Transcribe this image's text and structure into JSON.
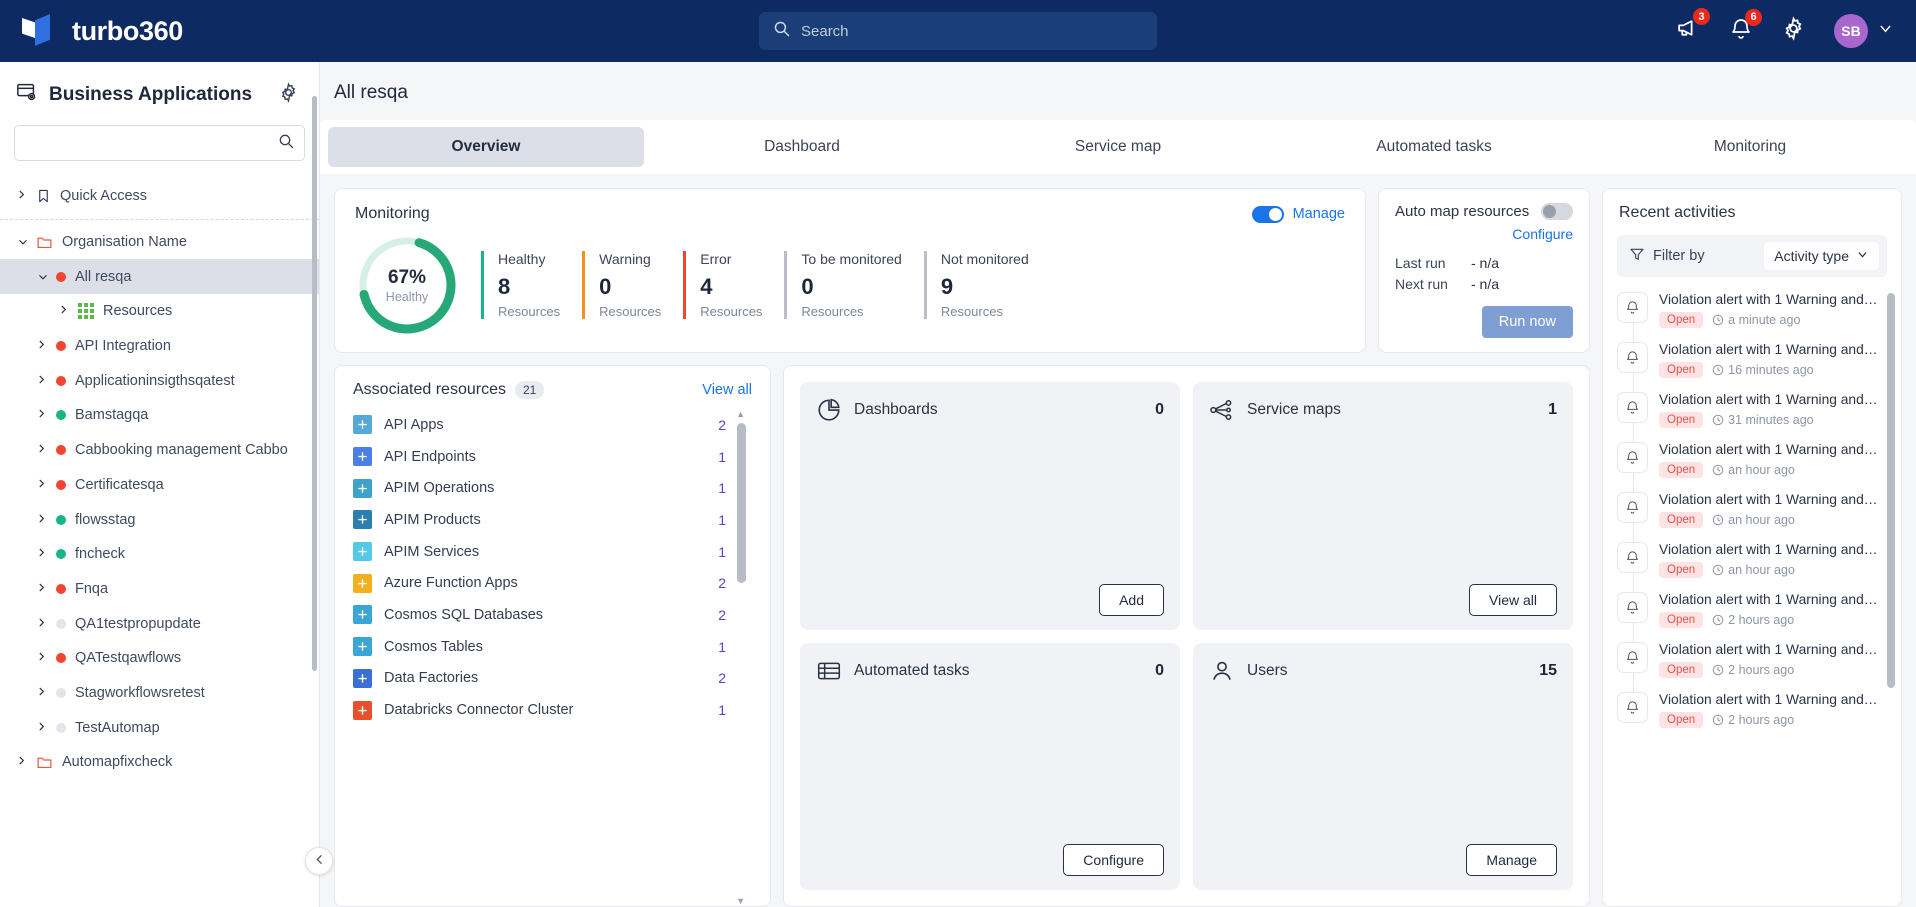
{
  "topbar": {
    "brand": "turbo360",
    "search_placeholder": "Search",
    "announcements_badge": "3",
    "notifications_badge": "6",
    "avatar_initials": "SB"
  },
  "sidebar": {
    "title": "Business Applications",
    "search_value": "",
    "search_placeholder": "",
    "groups": [
      {
        "label": "Quick Access",
        "icon": "bookmark-icon",
        "depth": 1,
        "expanded": false,
        "type": "bookmark"
      },
      {
        "label": "Organisation Name",
        "icon": "folder-icon",
        "depth": 1,
        "expanded": true,
        "type": "folder"
      },
      {
        "label": "All resqa",
        "depth": 2,
        "expanded": true,
        "selected": true,
        "status": "#f2442e"
      },
      {
        "label": "Resources",
        "depth": 3,
        "expanded": false,
        "type": "grid"
      },
      {
        "label": "API Integration",
        "depth": 2,
        "expanded": false,
        "status": "#f2442e"
      },
      {
        "label": "Applicationinsigthsqatest",
        "depth": 2,
        "expanded": false,
        "status": "#f2442e"
      },
      {
        "label": "Bamstagqa",
        "depth": 2,
        "expanded": false,
        "status": "#19b589"
      },
      {
        "label": "Cabbooking management Cabbo",
        "depth": 2,
        "expanded": false,
        "status": "#f2442e"
      },
      {
        "label": "Certificatesqa",
        "depth": 2,
        "expanded": false,
        "status": "#f2442e"
      },
      {
        "label": "flowsstag",
        "depth": 2,
        "expanded": false,
        "status": "#19b589"
      },
      {
        "label": "fncheck",
        "depth": 2,
        "expanded": false,
        "status": "#19b589"
      },
      {
        "label": "Fnqa",
        "depth": 2,
        "expanded": false,
        "status": "#f2442e"
      },
      {
        "label": "QA1testpropupdate",
        "depth": 2,
        "expanded": false,
        "status": "#e2e5ea"
      },
      {
        "label": "QATestqawflows",
        "depth": 2,
        "expanded": false,
        "status": "#f2442e"
      },
      {
        "label": "Stagworkflowsretest",
        "depth": 2,
        "expanded": false,
        "status": "#e2e5ea"
      },
      {
        "label": "TestAutomap",
        "depth": 2,
        "expanded": false,
        "status": "#e2e5ea"
      },
      {
        "label": "Automapfixcheck",
        "icon": "folder-icon",
        "depth": 1,
        "expanded": false,
        "type": "folder"
      }
    ]
  },
  "main": {
    "page_title": "All resqa",
    "tabs": [
      {
        "label": "Overview",
        "active": true
      },
      {
        "label": "Dashboard",
        "active": false
      },
      {
        "label": "Service map",
        "active": false
      },
      {
        "label": "Automated tasks",
        "active": false
      },
      {
        "label": "Monitoring",
        "active": false
      }
    ]
  },
  "monitoring": {
    "title": "Monitoring",
    "manage_label": "Manage",
    "manage_on": true,
    "donut_percent": "67%",
    "donut_sub": "Healthy",
    "stats": [
      {
        "label": "Healthy",
        "value": "8",
        "sub": "Resources",
        "color": "#19b589"
      },
      {
        "label": "Warning",
        "value": "0",
        "sub": "Resources",
        "color": "#f5901f"
      },
      {
        "label": "Error",
        "value": "4",
        "sub": "Resources",
        "color": "#f2442e"
      },
      {
        "label": "To be monitored",
        "value": "0",
        "sub": "Resources",
        "color": "#b9bec7"
      },
      {
        "label": "Not monitored",
        "value": "9",
        "sub": "Resources",
        "color": "#b9bec7"
      }
    ]
  },
  "automap": {
    "title": "Auto map resources",
    "toggle_on": false,
    "configure_label": "Configure",
    "last_run_label": "Last run",
    "last_run_value": "- n/a",
    "next_run_label": "Next run",
    "next_run_value": "- n/a",
    "run_now_label": "Run now"
  },
  "associated_resources": {
    "title": "Associated resources",
    "count": "21",
    "view_all_label": "View all",
    "items": [
      {
        "name": "API Apps",
        "count": "2",
        "icon": "api-apps-icon",
        "color": "#54a9d8"
      },
      {
        "name": "API Endpoints",
        "count": "1",
        "icon": "api-endpoints-icon",
        "color": "#4a7ee8"
      },
      {
        "name": "APIM Operations",
        "count": "1",
        "icon": "apim-operations-icon",
        "color": "#3da2c9"
      },
      {
        "name": "APIM Products",
        "count": "1",
        "icon": "apim-products-icon",
        "color": "#2d7fb0"
      },
      {
        "name": "APIM Services",
        "count": "1",
        "icon": "apim-services-icon",
        "color": "#55c8e8"
      },
      {
        "name": "Azure Function Apps",
        "count": "2",
        "icon": "azure-function-apps-icon",
        "color": "#f2b01e"
      },
      {
        "name": "Cosmos SQL Databases",
        "count": "2",
        "icon": "cosmos-sql-icon",
        "color": "#3aa6d8"
      },
      {
        "name": "Cosmos Tables",
        "count": "1",
        "icon": "cosmos-tables-icon",
        "color": "#3aa6d8"
      },
      {
        "name": "Data Factories",
        "count": "2",
        "icon": "data-factories-icon",
        "color": "#3b6fd4"
      },
      {
        "name": "Databricks Connector Cluster",
        "count": "1",
        "icon": "databricks-icon",
        "color": "#e8502d"
      }
    ]
  },
  "tiles": [
    {
      "name": "Dashboards",
      "value": "0",
      "action": "Add",
      "icon": "pie-chart-icon"
    },
    {
      "name": "Service maps",
      "value": "1",
      "action": "View all",
      "icon": "service-map-icon"
    },
    {
      "name": "Automated tasks",
      "value": "0",
      "action": "Configure",
      "icon": "automated-tasks-icon"
    },
    {
      "name": "Users",
      "value": "15",
      "action": "Manage",
      "icon": "user-icon"
    }
  ],
  "recent_activities": {
    "title": "Recent activities",
    "filter_label": "Filter by",
    "activity_type_label": "Activity type",
    "items": [
      {
        "title": "Violation alert with 1 Warning and…",
        "status": "Open",
        "time": "a minute ago"
      },
      {
        "title": "Violation alert with 1 Warning and…",
        "status": "Open",
        "time": "16 minutes ago"
      },
      {
        "title": "Violation alert with 1 Warning and…",
        "status": "Open",
        "time": "31 minutes ago"
      },
      {
        "title": "Violation alert with 1 Warning and…",
        "status": "Open",
        "time": "an hour ago"
      },
      {
        "title": "Violation alert with 1 Warning and…",
        "status": "Open",
        "time": "an hour ago"
      },
      {
        "title": "Violation alert with 1 Warning and…",
        "status": "Open",
        "time": "an hour ago"
      },
      {
        "title": "Violation alert with 1 Warning and…",
        "status": "Open",
        "time": "2 hours ago"
      },
      {
        "title": "Violation alert with 1 Warning and…",
        "status": "Open",
        "time": "2 hours ago"
      },
      {
        "title": "Violation alert with 1 Warning and…",
        "status": "Open",
        "time": "2 hours ago"
      }
    ]
  },
  "chart_data": {
    "type": "pie",
    "title": "Monitoring health",
    "categories": [
      "Healthy",
      "Warning",
      "Error",
      "To be monitored",
      "Not monitored"
    ],
    "values": [
      8,
      0,
      4,
      0,
      9
    ],
    "percent_healthy": 67,
    "colors": [
      "#19b589",
      "#f5901f",
      "#f2442e",
      "#b9bec7",
      "#b9bec7"
    ],
    "legend": "right"
  }
}
